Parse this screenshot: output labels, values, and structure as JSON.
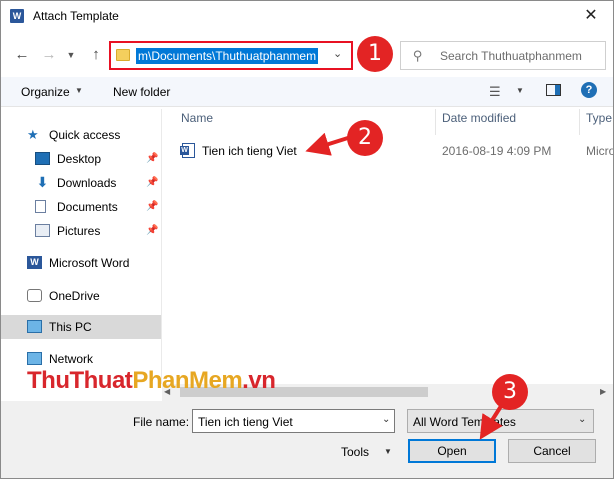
{
  "window": {
    "title": "Attach Template",
    "close_glyph": "✕"
  },
  "address_bar": {
    "path_text": "m\\Documents\\Thuthuatphanmem",
    "dropdown_glyph": "⌄"
  },
  "search": {
    "placeholder": "Search Thuthuatphanmem"
  },
  "toolbar": {
    "organize_label": "Organize",
    "new_folder_label": "New folder"
  },
  "nav_pane": {
    "items": [
      {
        "label": "Quick access",
        "icon": "star-icon",
        "level": 0,
        "pinned": false,
        "selected": false
      },
      {
        "label": "Desktop",
        "icon": "desktop-icon",
        "level": 1,
        "pinned": true,
        "selected": false
      },
      {
        "label": "Downloads",
        "icon": "download-icon",
        "level": 1,
        "pinned": true,
        "selected": false
      },
      {
        "label": "Documents",
        "icon": "document-icon",
        "level": 1,
        "pinned": true,
        "selected": false
      },
      {
        "label": "Pictures",
        "icon": "pictures-icon",
        "level": 1,
        "pinned": true,
        "selected": false
      },
      {
        "label": "Microsoft Word",
        "icon": "word-icon",
        "level": 0,
        "pinned": false,
        "selected": false
      },
      {
        "label": "OneDrive",
        "icon": "onedrive-icon",
        "level": 0,
        "pinned": false,
        "selected": false
      },
      {
        "label": "This PC",
        "icon": "pc-icon",
        "level": 0,
        "pinned": false,
        "selected": true
      },
      {
        "label": "Network",
        "icon": "network-icon",
        "level": 0,
        "pinned": false,
        "selected": false
      }
    ]
  },
  "file_list": {
    "columns": [
      "Name",
      "Date modified",
      "Type"
    ],
    "rows": [
      {
        "name": "Tien ich tieng Viet",
        "date_modified": "2016-08-19 4:09 PM",
        "type": "Micro"
      }
    ]
  },
  "bottom": {
    "file_name_label": "File name:",
    "file_name_value": "Tien ich tieng Viet",
    "filter_value": "All Word Templates",
    "tools_label": "Tools",
    "open_label": "Open",
    "cancel_label": "Cancel"
  },
  "annotations": {
    "badges": [
      "1",
      "2",
      "3"
    ],
    "color": "#e32424"
  },
  "watermark": {
    "part1": "ThuThuat",
    "part2": "PhanMem",
    "part3": ".vn"
  },
  "colors": {
    "accent": "#0078d7",
    "word_blue": "#2b579a",
    "highlight_border": "#e81123"
  }
}
